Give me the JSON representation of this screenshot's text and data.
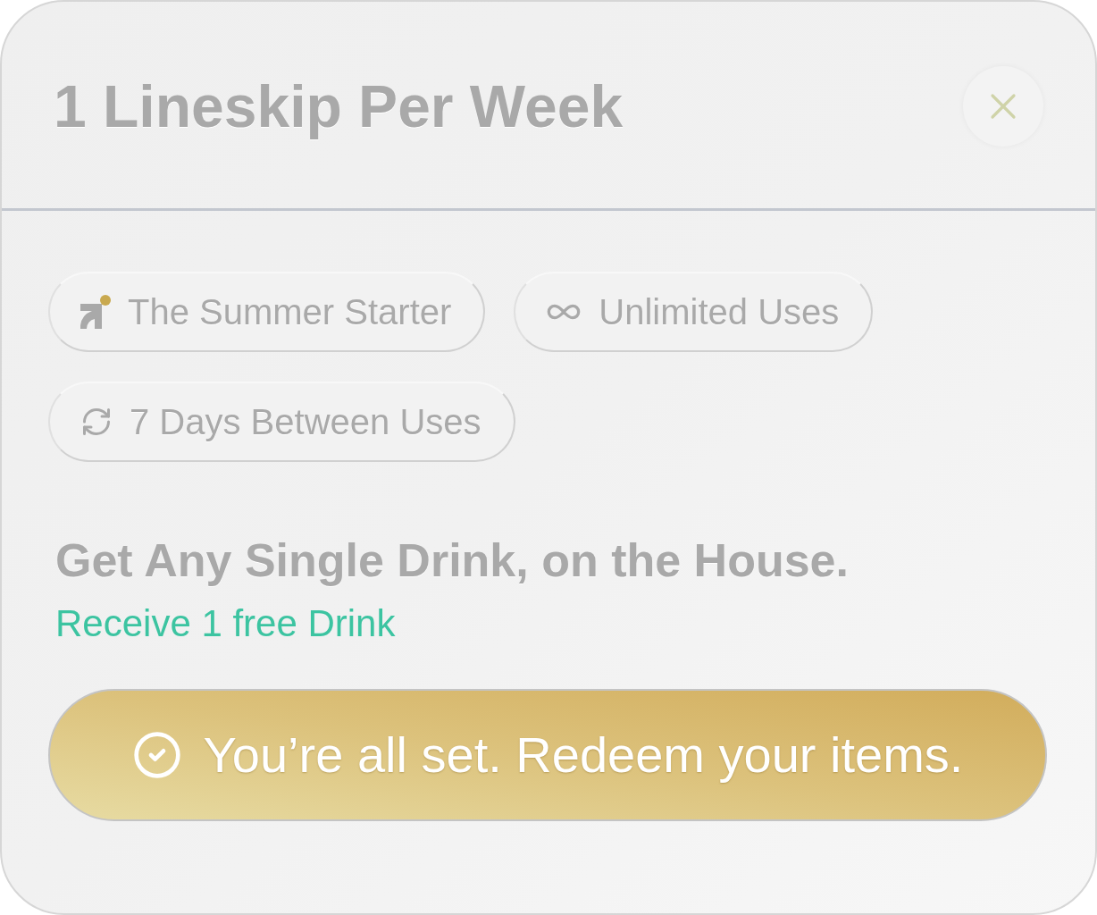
{
  "dialog": {
    "title": "1 Lineskip Per Week"
  },
  "tags": [
    {
      "kind": "brand",
      "label": "The Summer Starter"
    },
    {
      "kind": "unlimited",
      "label": "Unlimited Uses"
    },
    {
      "kind": "repeat",
      "label": "7 Days Between Uses"
    }
  ],
  "offer": {
    "headline": "Get Any Single Drink, on the House.",
    "detail": "Receive 1 free Drink"
  },
  "redeem_button": {
    "label": "You’re all set. Redeem your items."
  }
}
